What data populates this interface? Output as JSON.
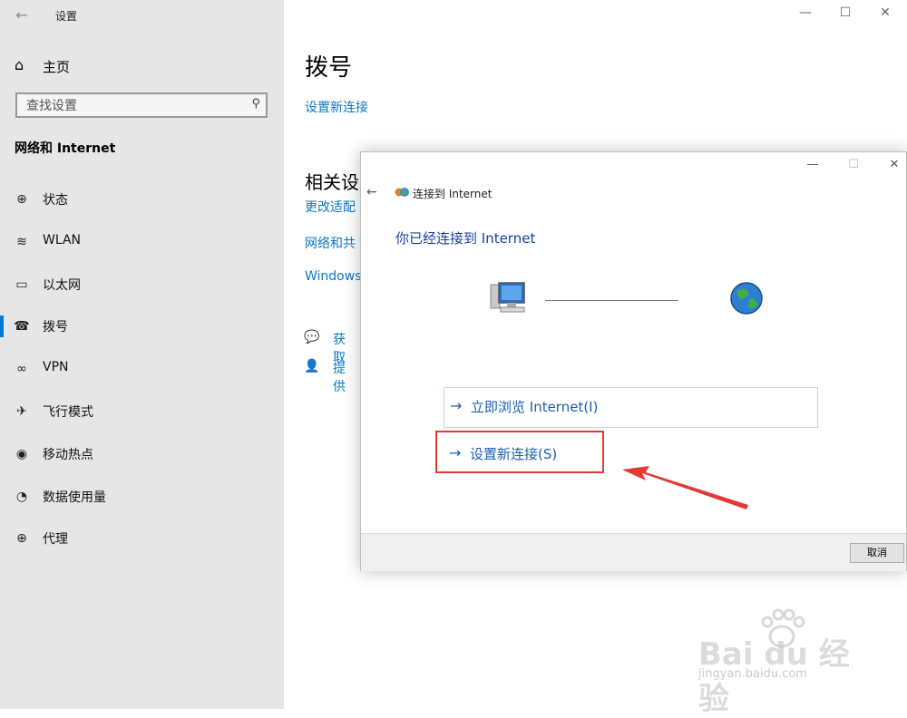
{
  "settings": {
    "app_title": "设置",
    "home_label": "主页",
    "search_placeholder": "查找设置",
    "section_title": "网络和 Internet",
    "nav_items": [
      {
        "label": "状态",
        "icon": "globe-status-icon"
      },
      {
        "label": "WLAN",
        "icon": "wifi-icon"
      },
      {
        "label": "以太网",
        "icon": "ethernet-icon"
      },
      {
        "label": "拨号",
        "icon": "dialup-icon",
        "active": true
      },
      {
        "label": "VPN",
        "icon": "vpn-icon"
      },
      {
        "label": "飞行模式",
        "icon": "airplane-icon"
      },
      {
        "label": "移动热点",
        "icon": "hotspot-icon"
      },
      {
        "label": "数据使用量",
        "icon": "data-usage-icon"
      },
      {
        "label": "代理",
        "icon": "proxy-globe-icon"
      }
    ],
    "page_title": "拨号",
    "setup_link": "设置新连接",
    "related_title": "相关设",
    "related_links": [
      "更改适配",
      "网络和共",
      "Windows"
    ],
    "help_links": [
      "获取",
      "提供"
    ]
  },
  "dialog": {
    "title": "连接到 Internet",
    "heading": "你已经连接到 Internet",
    "option_browse": "立即浏览 Internet(I)",
    "option_setup": "设置新连接(S)",
    "cancel_label": "取消"
  },
  "watermark": {
    "brand": "Bai du 经验",
    "url": "jingyan.baidu.com"
  },
  "colors": {
    "accent": "#0078d7",
    "link": "#0b78c5",
    "highlight": "#e53935"
  }
}
